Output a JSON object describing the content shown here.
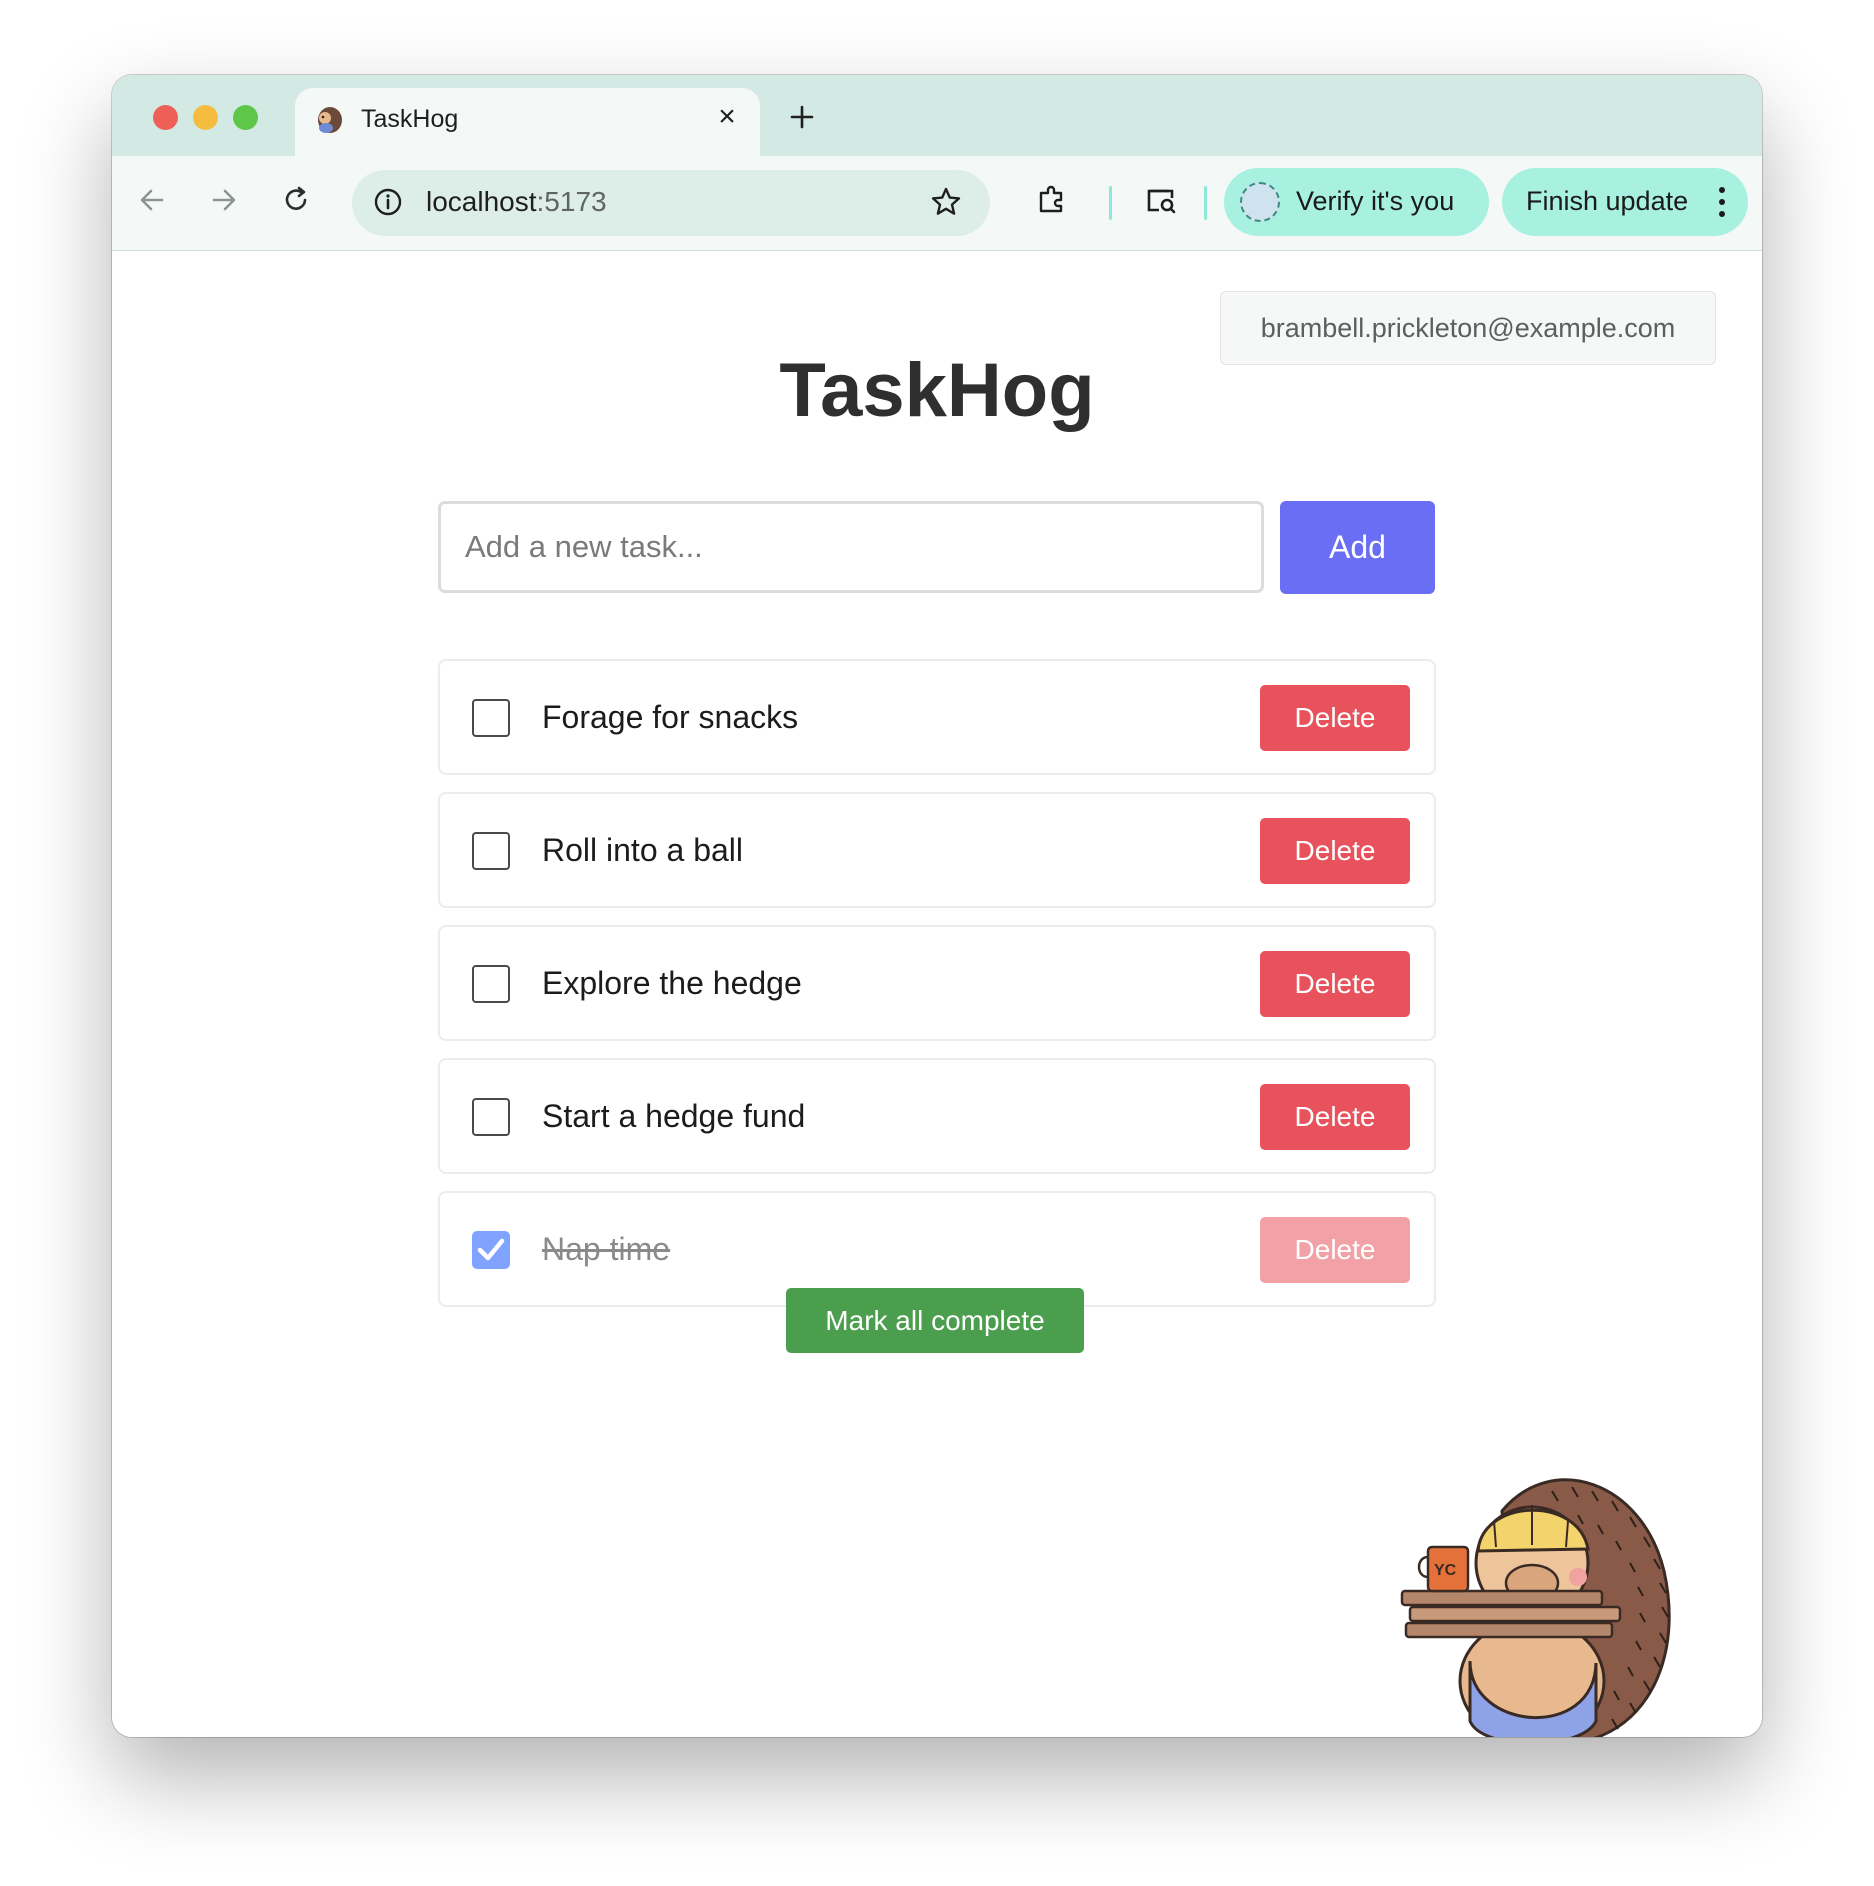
{
  "browser": {
    "tab_title": "TaskHog",
    "tab_close_icon": "×",
    "url_host": "localhost",
    "url_port": ":5173",
    "verify_label": "Verify it's you",
    "finish_update_label": "Finish update"
  },
  "header": {
    "user_email": "brambell.prickleton@example.com",
    "title": "TaskHog"
  },
  "new_task": {
    "placeholder": "Add a new task...",
    "value": "",
    "add_label": "Add"
  },
  "tasks": [
    {
      "text": "Forage for snacks",
      "done": false,
      "delete_label": "Delete"
    },
    {
      "text": "Roll into a ball",
      "done": false,
      "delete_label": "Delete"
    },
    {
      "text": "Explore the hedge",
      "done": false,
      "delete_label": "Delete"
    },
    {
      "text": "Start a hedge fund",
      "done": false,
      "delete_label": "Delete"
    },
    {
      "text": "Nap time",
      "done": true,
      "delete_label": "Delete"
    }
  ],
  "actions": {
    "mark_all_label": "Mark all complete"
  },
  "mascot": {
    "icon": "hedgehog-builder-icon",
    "mug_text": "YC"
  },
  "colors": {
    "accent": "#6a6ef5",
    "delete": "#e8525c",
    "complete": "#4a9e4e",
    "tab_strip": "#d3e9e3",
    "pill": "#a8f0df"
  }
}
